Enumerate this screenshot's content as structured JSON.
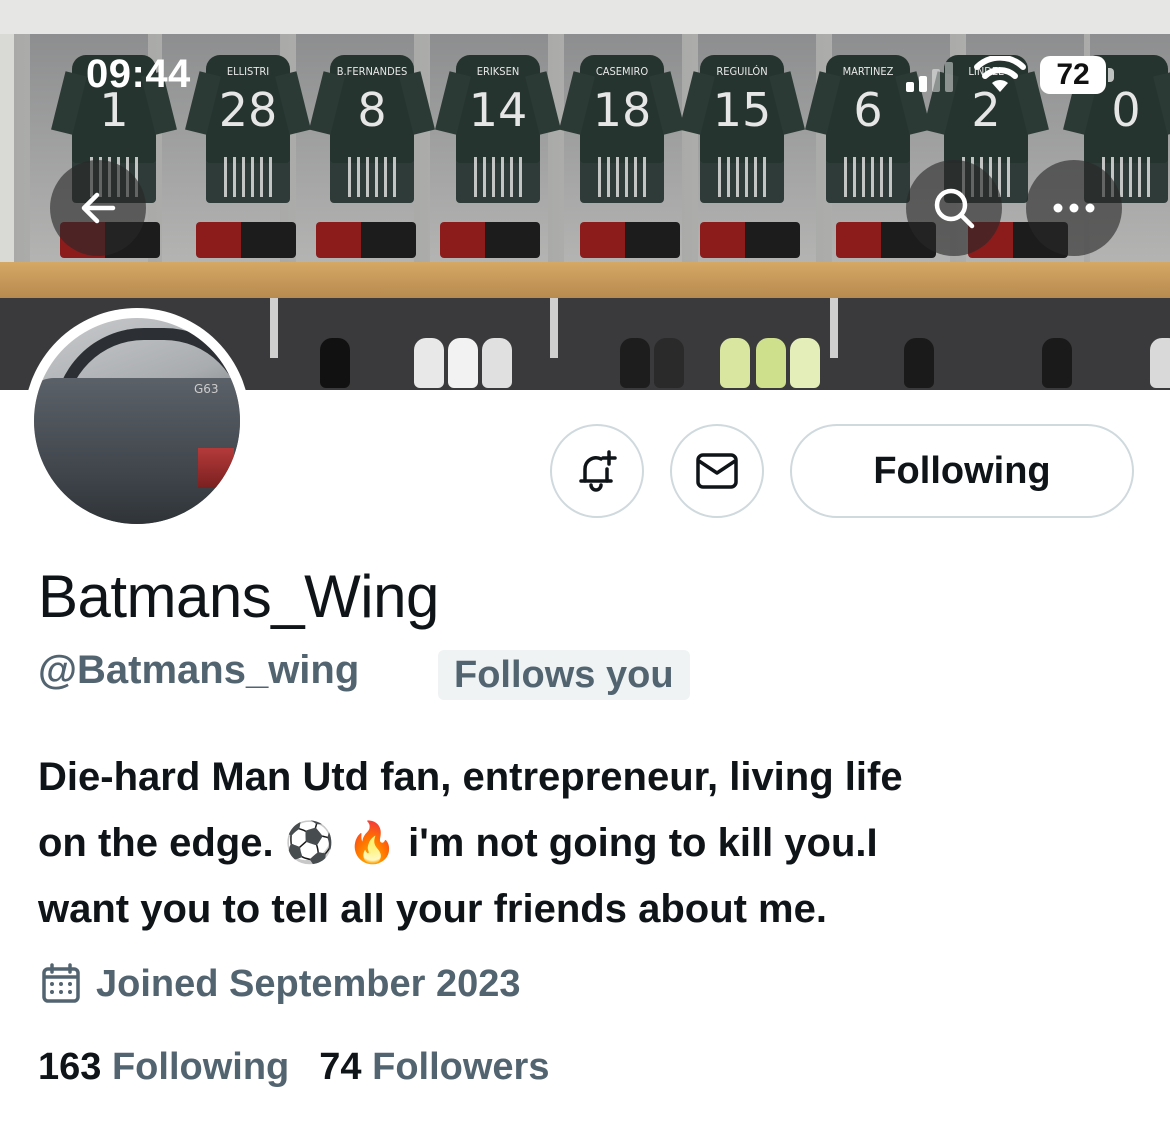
{
  "status_bar": {
    "time": "09:44",
    "battery": "72"
  },
  "banner": {
    "shirts": [
      {
        "name": "ELLISTRI",
        "number": "28"
      },
      {
        "name": "B.FERNANDES",
        "number": "8"
      },
      {
        "name": "ERIKSEN",
        "number": "14"
      },
      {
        "name": "CASEMIRO",
        "number": "18"
      },
      {
        "name": "REGUILÓN",
        "number": "15"
      },
      {
        "name": "MARTINEZ",
        "number": "6"
      },
      {
        "name": "LINDEL",
        "number": "2"
      }
    ]
  },
  "header_buttons": {
    "back_icon": "arrow-left-icon",
    "search_icon": "search-icon",
    "more_icon": "more-icon"
  },
  "actions": {
    "notify_icon": "bell-plus-icon",
    "message_icon": "mail-icon",
    "following_label": "Following"
  },
  "profile": {
    "display_name": "Batmans_Wing",
    "handle": "@Batmans_wing",
    "follows_you": "Follows you",
    "bio_line1": "Die-hard Man Utd fan, entrepreneur, living life",
    "bio_line2_pre": "on the edge.",
    "bio_emoji": "⚽ 🔥",
    "bio_line2_post": "i'm not going to kill you.I",
    "bio_line3": "want you to tell all your friends about me.",
    "joined": "Joined September 2023",
    "following_count": "163",
    "following_label": "Following",
    "followers_count": "74",
    "followers_label": "Followers"
  },
  "colors": {
    "text_primary": "#0f1419",
    "text_secondary": "#536471",
    "border": "#cfd9de",
    "badge_bg": "#eff3f4"
  }
}
